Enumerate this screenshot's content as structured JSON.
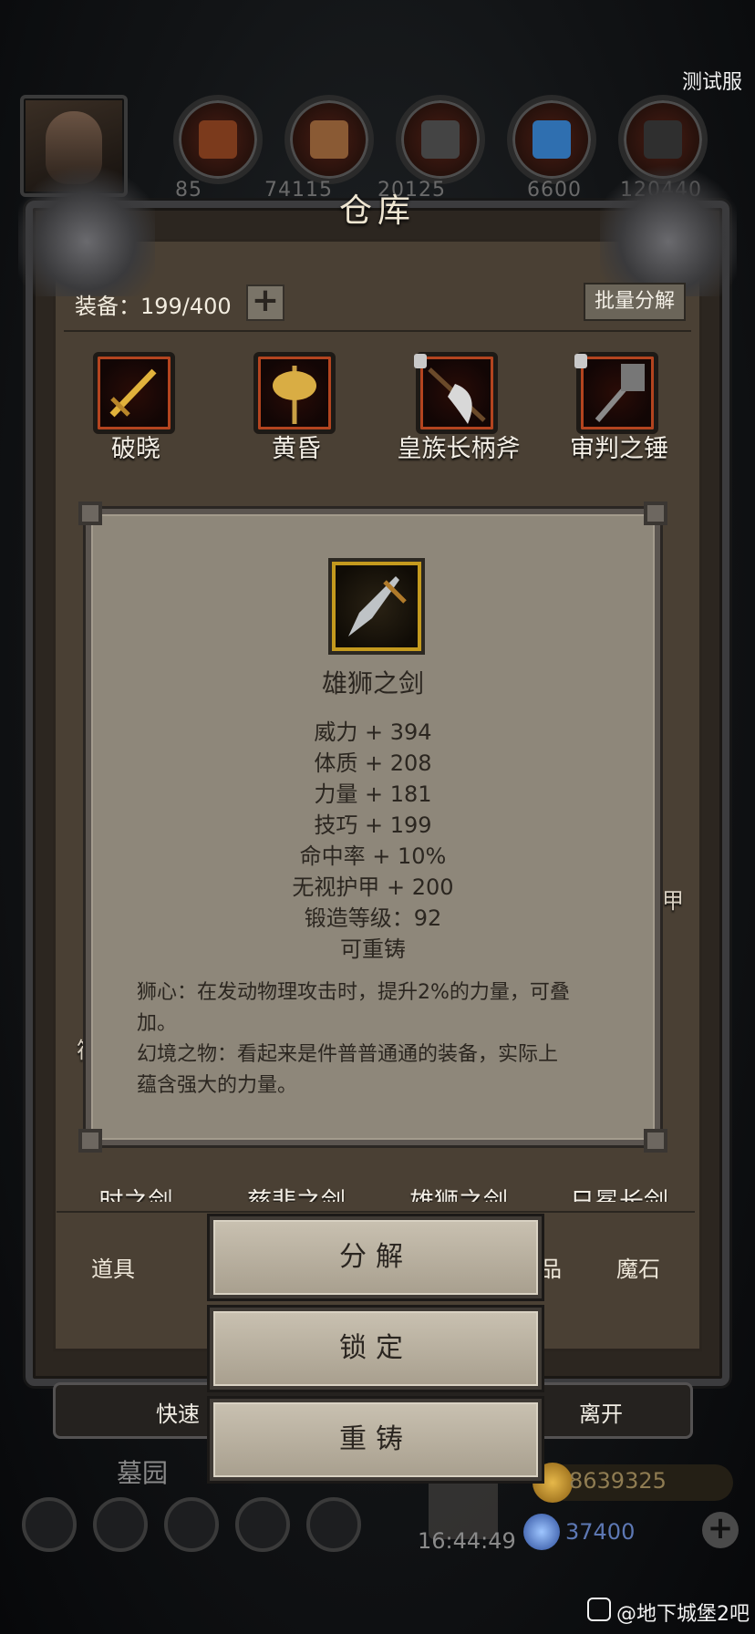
{
  "server_tag": "测试服",
  "resources": [
    {
      "icon": "leather-icon",
      "value": "85"
    },
    {
      "icon": "wood-plank-icon",
      "value": "74115"
    },
    {
      "icon": "iron-ingot-icon",
      "value": "20125"
    },
    {
      "icon": "blue-crystal-icon",
      "value": "6600"
    },
    {
      "icon": "steel-ingot-icon",
      "value": "120440"
    }
  ],
  "warehouse": {
    "title": "仓库",
    "equipment_label": "装备：199/400",
    "batch_button": "批量分解",
    "row1": [
      {
        "name": "破晓",
        "locked": false,
        "icon": "golden-sword-icon"
      },
      {
        "name": "黄昏",
        "locked": false,
        "icon": "golden-axe-icon"
      },
      {
        "name": "皇族长柄斧",
        "locked": true,
        "icon": "halberd-icon"
      },
      {
        "name": "审判之锤",
        "locked": true,
        "icon": "hammer-icon"
      }
    ],
    "row_bottom": [
      "时之剑",
      "慈悲之剑",
      "雄狮之剑",
      "日冕长剑"
    ],
    "side_fragments": {
      "left_char": "符",
      "right_char": "甲"
    },
    "tabs": {
      "left": "道具",
      "middle_fragment": "品",
      "right": "魔石"
    },
    "actions": {
      "left": "快速",
      "right": "离开"
    }
  },
  "tooltip": {
    "item_name": "雄狮之剑",
    "stats": [
      "威力 + 394",
      "体质 + 208",
      "力量 + 181",
      "技巧 + 199",
      "命中率 + 10%",
      "无视护甲 + 200",
      "锻造等级：92",
      "可重铸"
    ],
    "description": [
      "狮心：在发动物理攻击时，提升2%的力量，可叠",
      "加。",
      "幻境之物：看起来是件普普通通的装备，实际上",
      "蕴含强大的力量。"
    ]
  },
  "buttons": {
    "decompose": "分解",
    "lock": "锁定",
    "reforge": "重铸"
  },
  "bottom": {
    "location": "墓园",
    "gold": "8639325",
    "gems": "37400",
    "time": "16:44:49"
  },
  "watermark": "@地下城堡2吧"
}
